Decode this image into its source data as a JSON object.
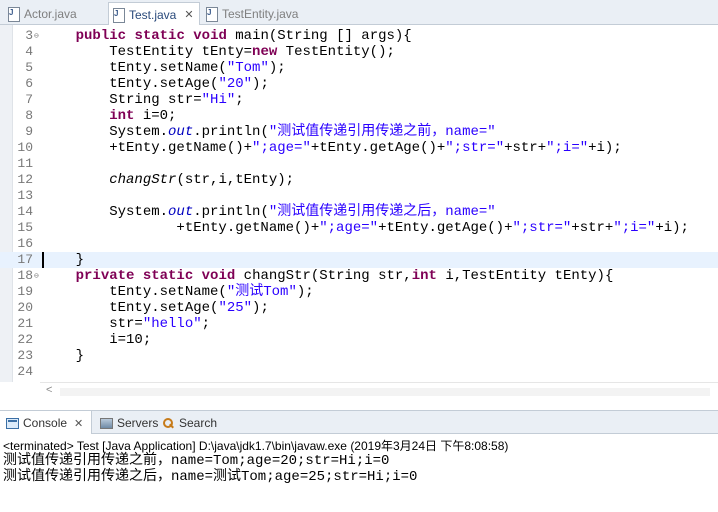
{
  "editor_tabs": [
    {
      "label": "Actor.java",
      "active": false
    },
    {
      "label": "Test.java",
      "active": true
    },
    {
      "label": "TestEntity.java",
      "active": false
    }
  ],
  "tab_close_glyph": "✕",
  "code_lines": [
    {
      "num": "3",
      "fold": "⊖",
      "tokens": [
        {
          "t": "    "
        },
        {
          "t": "public",
          "c": "kw"
        },
        {
          "t": " "
        },
        {
          "t": "static",
          "c": "kw"
        },
        {
          "t": " "
        },
        {
          "t": "void",
          "c": "kw"
        },
        {
          "t": " main(String [] args){"
        }
      ]
    },
    {
      "num": "4",
      "tokens": [
        {
          "t": "        TestEntity tEnty="
        },
        {
          "t": "new",
          "c": "kw"
        },
        {
          "t": " TestEntity();"
        }
      ]
    },
    {
      "num": "5",
      "tokens": [
        {
          "t": "        tEnty.setName("
        },
        {
          "t": "\"Tom\"",
          "c": "str"
        },
        {
          "t": ");"
        }
      ]
    },
    {
      "num": "6",
      "tokens": [
        {
          "t": "        tEnty.setAge("
        },
        {
          "t": "\"20\"",
          "c": "str"
        },
        {
          "t": ");"
        }
      ]
    },
    {
      "num": "7",
      "tokens": [
        {
          "t": "        String str="
        },
        {
          "t": "\"Hi\"",
          "c": "str"
        },
        {
          "t": ";"
        }
      ]
    },
    {
      "num": "8",
      "tokens": [
        {
          "t": "        "
        },
        {
          "t": "int",
          "c": "kw"
        },
        {
          "t": " i=0;"
        }
      ]
    },
    {
      "num": "9",
      "tokens": [
        {
          "t": "        System."
        },
        {
          "t": "out",
          "c": "fld"
        },
        {
          "t": ".println("
        },
        {
          "t": "\"测试值传递引用传递之前，name=\"",
          "c": "str"
        }
      ]
    },
    {
      "num": "10",
      "tokens": [
        {
          "t": "        +tEnty.getName()+"
        },
        {
          "t": "\";age=\"",
          "c": "str"
        },
        {
          "t": "+tEnty.getAge()+"
        },
        {
          "t": "\";str=\"",
          "c": "str"
        },
        {
          "t": "+str+"
        },
        {
          "t": "\";i=\"",
          "c": "str"
        },
        {
          "t": "+i);"
        }
      ]
    },
    {
      "num": "11",
      "tokens": []
    },
    {
      "num": "12",
      "tokens": [
        {
          "t": "        "
        },
        {
          "t": "changStr",
          "c": "ital"
        },
        {
          "t": "(str,i,tEnty);"
        }
      ]
    },
    {
      "num": "13",
      "tokens": []
    },
    {
      "num": "14",
      "tokens": [
        {
          "t": "        System."
        },
        {
          "t": "out",
          "c": "fld"
        },
        {
          "t": ".println("
        },
        {
          "t": "\"测试值传递引用传递之后，name=\"",
          "c": "str"
        }
      ]
    },
    {
      "num": "15",
      "tokens": [
        {
          "t": "                +tEnty.getName()+"
        },
        {
          "t": "\";age=\"",
          "c": "str"
        },
        {
          "t": "+tEnty.getAge()+"
        },
        {
          "t": "\";str=\"",
          "c": "str"
        },
        {
          "t": "+str+"
        },
        {
          "t": "\";i=\"",
          "c": "str"
        },
        {
          "t": "+i);"
        }
      ]
    },
    {
      "num": "16",
      "tokens": []
    },
    {
      "num": "17",
      "current": true,
      "tokens": [
        {
          "t": "    }"
        }
      ]
    },
    {
      "num": "18",
      "fold": "⊖",
      "tokens": [
        {
          "t": "    "
        },
        {
          "t": "private",
          "c": "kw"
        },
        {
          "t": " "
        },
        {
          "t": "static",
          "c": "kw"
        },
        {
          "t": " "
        },
        {
          "t": "void",
          "c": "kw"
        },
        {
          "t": " changStr(String str,"
        },
        {
          "t": "int",
          "c": "kw"
        },
        {
          "t": " i,TestEntity tEnty){"
        }
      ]
    },
    {
      "num": "19",
      "tokens": [
        {
          "t": "        tEnty.setName("
        },
        {
          "t": "\"测试Tom\"",
          "c": "str"
        },
        {
          "t": ");"
        }
      ]
    },
    {
      "num": "20",
      "tokens": [
        {
          "t": "        tEnty.setAge("
        },
        {
          "t": "\"25\"",
          "c": "str"
        },
        {
          "t": ");"
        }
      ]
    },
    {
      "num": "21",
      "tokens": [
        {
          "t": "        str="
        },
        {
          "t": "\"hello\"",
          "c": "str"
        },
        {
          "t": ";"
        }
      ]
    },
    {
      "num": "22",
      "tokens": [
        {
          "t": "        i=10;"
        }
      ]
    },
    {
      "num": "23",
      "tokens": [
        {
          "t": "    }"
        }
      ]
    },
    {
      "num": "24",
      "tokens": []
    }
  ],
  "scroll_left_glyph": "<",
  "views": {
    "console": {
      "label": "Console"
    },
    "servers": {
      "label": "Servers"
    },
    "search": {
      "label": "Search"
    }
  },
  "console": {
    "status": "<terminated> Test [Java Application] D:\\java\\jdk1.7\\bin\\javaw.exe (2019年3月24日 下午8:08:58)",
    "output": [
      "测试值传递引用传递之前，name=Tom;age=20;str=Hi;i=0",
      "测试值传递引用传递之后，name=测试Tom;age=25;str=Hi;i=0"
    ]
  },
  "colors": {
    "keyword": "#7f0055",
    "string": "#2a00ff",
    "field": "#0000c0",
    "current_line": "#e8f2fe"
  }
}
